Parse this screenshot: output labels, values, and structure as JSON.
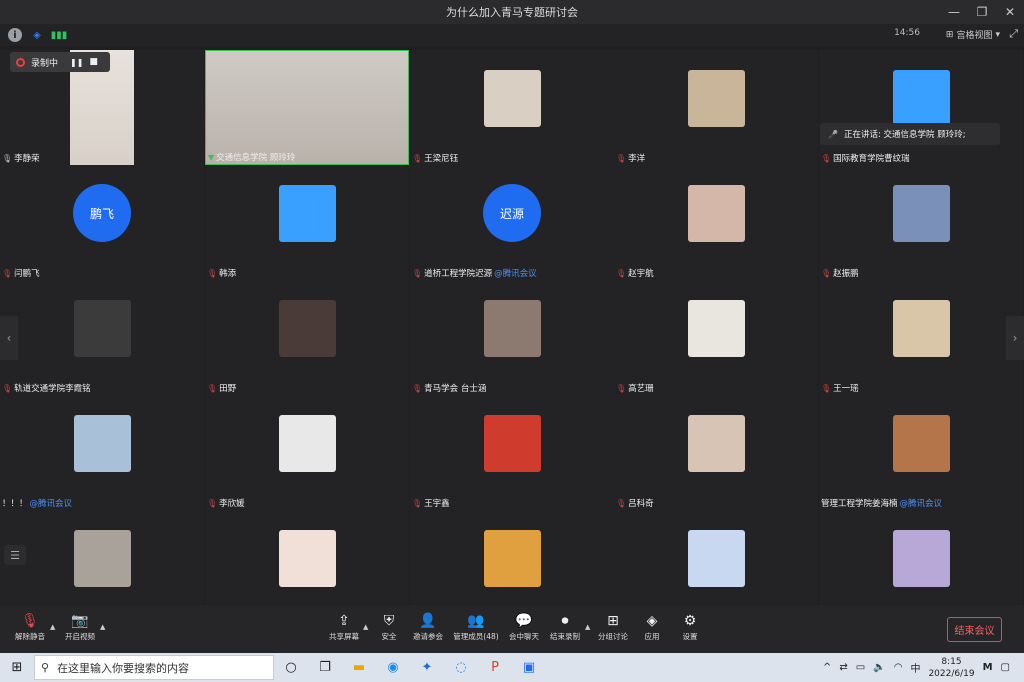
{
  "window": {
    "title": "为什么加入青马专题研讨会",
    "minimize": "—",
    "restore": "❐",
    "close": "✕"
  },
  "infobar": {
    "time": "14:56",
    "view_mode": "宫格视图",
    "info_glyph": "i",
    "shield_glyph": "◈",
    "signal_glyph": "▮▮▮",
    "view_glyph": "⊞",
    "caret_glyph": "▾",
    "fullscreen_glyph": "⤢"
  },
  "recording": {
    "label": "录制中",
    "pause_glyph": "❚❚",
    "stop_glyph": "■"
  },
  "speaking": {
    "text": "正在讲话: 交通信息学院 顾玲玲;",
    "icon": "🎤"
  },
  "participants": [
    {
      "name": "李静荣",
      "mic": "on"
    },
    {
      "name": "交通信息学院 顾玲玲",
      "mic": "green"
    },
    {
      "name": "王梁尼钰",
      "mic": "muted"
    },
    {
      "name": "李洋",
      "mic": "muted"
    },
    {
      "name": "国际教育学院曹纹瑞",
      "mic": "muted"
    },
    {
      "name": "闫鹏飞",
      "mic": "muted"
    },
    {
      "name": "韩添",
      "mic": "muted"
    },
    {
      "name": "道桥工程学院迟源",
      "brand": "@腾讯会议",
      "mic": "muted"
    },
    {
      "name": "赵宇航",
      "mic": "muted"
    },
    {
      "name": "赵振鹏",
      "mic": "muted"
    },
    {
      "name": "轨道交通学院李霞铭",
      "mic": "muted"
    },
    {
      "name": "田野",
      "mic": "muted"
    },
    {
      "name": "青马学会 台士涵",
      "mic": "muted"
    },
    {
      "name": "高艺珊",
      "mic": "muted"
    },
    {
      "name": "王一瑶",
      "mic": "muted"
    },
    {
      "name": "！！！",
      "brand": "@腾讯会议",
      "mic": "none"
    },
    {
      "name": "李欣媛",
      "mic": "muted"
    },
    {
      "name": "王宇鑫",
      "mic": "muted"
    },
    {
      "name": "吕科奇",
      "mic": "muted"
    },
    {
      "name": "管理工程学院姜海楠",
      "brand": "@腾讯会议",
      "mic": "none"
    }
  ],
  "circle_avatars": {
    "pengfei": "鹏飞",
    "chiyuan": "迟源"
  },
  "toolbar": {
    "unmute": "解除静音",
    "start_video": "开启视频",
    "share_screen": "共享屏幕",
    "security": "安全",
    "invite": "邀请参会",
    "manage_members": "管理成员(48)",
    "chat": "会中聊天",
    "end_recording": "结束录制",
    "breakout": "分组讨论",
    "apps": "应用",
    "settings": "设置",
    "end_meeting": "结束会议"
  },
  "taskbar": {
    "search_placeholder": "在这里输入你要搜索的内容",
    "time": "8:15",
    "date": "2022/6/19",
    "ime": "中"
  },
  "colors": {
    "accent": "#1f6cf0",
    "danger": "#e04a4a",
    "active_border": "#3cbf55"
  }
}
